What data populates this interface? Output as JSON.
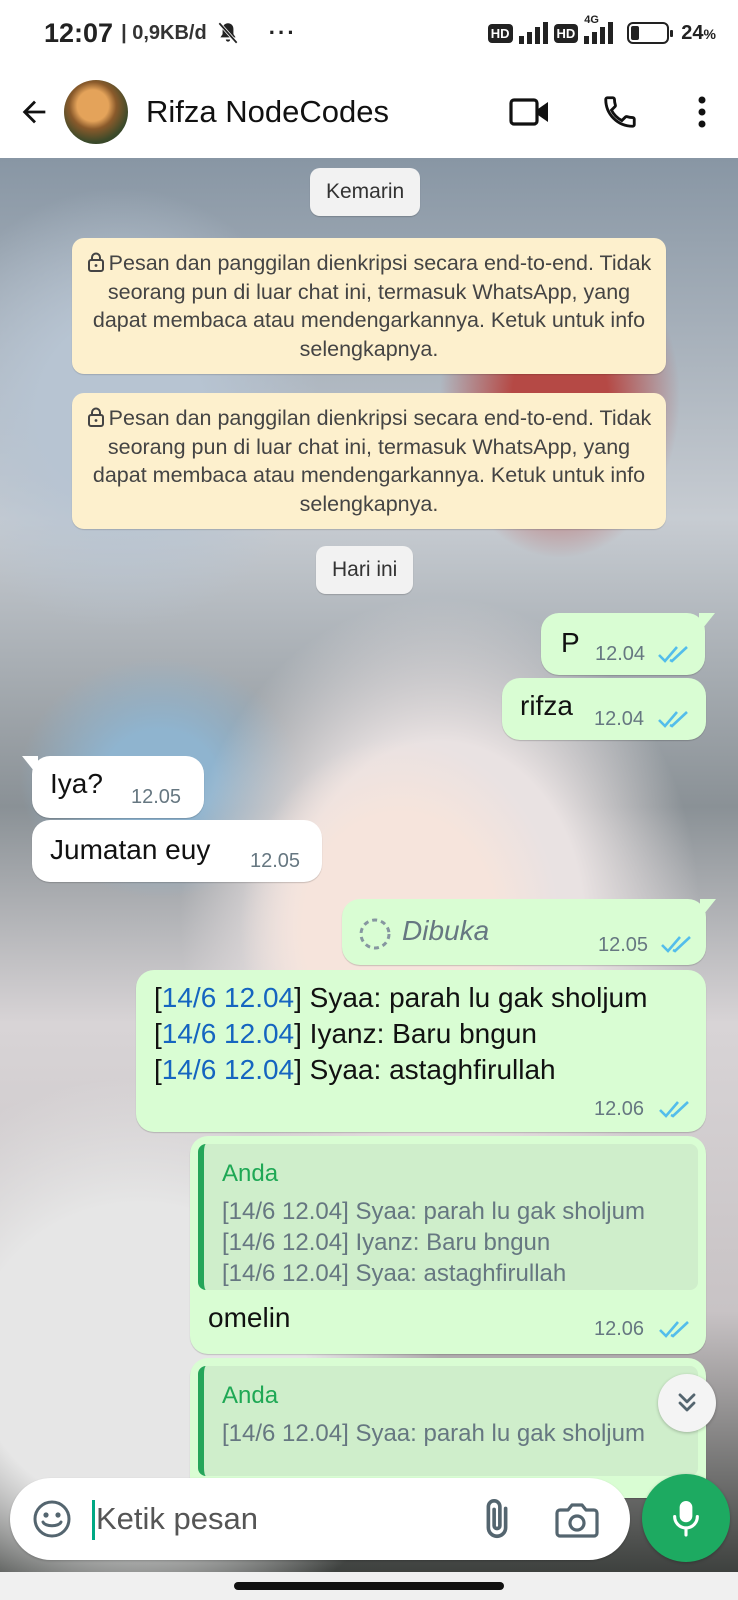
{
  "status_bar": {
    "time": "12:07",
    "network_speed": "| 0,9KB/d",
    "more": "···",
    "hd1": "HD",
    "hd2": "HD",
    "lte": "4G",
    "battery_percent": "24",
    "battery_unit": "%",
    "battery_level": 0.24
  },
  "header": {
    "contact_name": "Rifza NodeCodes"
  },
  "chat": {
    "date_yesterday": "Kemarin",
    "date_today": "Hari ini",
    "encryption_notice_1": "Pesan dan panggilan dienkripsi secara end-to-end. Tidak seorang pun di luar chat ini, termasuk WhatsApp, yang dapat membaca atau mendengarkannya. Ketuk untuk info selengkapnya.",
    "encryption_notice_2": "Pesan dan panggilan dienkripsi secara end-to-end. Tidak seorang pun di luar chat ini, termasuk WhatsApp, yang dapat membaca atau mendengarkannya. Ketuk untuk info selengkapnya.",
    "messages": [
      {
        "direction": "out",
        "text": "P",
        "time": "12.04",
        "status": "read"
      },
      {
        "direction": "out",
        "text": "rifza",
        "time": "12.04",
        "status": "read"
      },
      {
        "direction": "in",
        "text": "Iya?",
        "time": "12.05"
      },
      {
        "direction": "in",
        "text": "Jumatan euy",
        "time": "12.05"
      },
      {
        "direction": "out",
        "text": "Dibuka",
        "time": "12.05",
        "status": "read",
        "kind": "view-once-opened"
      },
      {
        "direction": "out",
        "time": "12.06",
        "status": "read",
        "lines": [
          {
            "ts": "14/6 12.04",
            "text": "] Syaa: parah lu gak sholjum"
          },
          {
            "ts": "14/6 12.04",
            "text": "] Iyanz: Baru bngun"
          },
          {
            "ts": "14/6 12.04",
            "text": "] Syaa: astaghfirullah"
          }
        ]
      },
      {
        "direction": "out",
        "time": "12.06",
        "status": "read",
        "quote_author": "Anda",
        "quote_lines": [
          "[14/6 12.04] Syaa: parah lu gak sholjum",
          "[14/6 12.04] Iyanz: Baru bngun",
          "[14/6 12.04] Syaa: astaghfirullah"
        ],
        "text": "omelin"
      },
      {
        "direction": "out",
        "quote_author": "Anda",
        "quote_lines": [
          "[14/6 12.04] Syaa: parah lu gak sholjum"
        ]
      }
    ]
  },
  "input": {
    "placeholder": "Ketik pesan"
  },
  "colors": {
    "outgoing_bubble": "#d9fdd3",
    "incoming_bubble": "#ffffff",
    "accent_green": "#1daa61",
    "read_tick_blue": "#53bdeb",
    "notice_yellow": "#fdf0cd"
  },
  "icons": {
    "back": "arrow-left-icon",
    "video": "video-camera-icon",
    "call": "phone-icon",
    "menu": "more-vertical-icon",
    "emoji": "emoji-icon",
    "attach": "paperclip-icon",
    "camera": "camera-icon",
    "mic": "microphone-icon",
    "scroll": "double-chevron-down-icon",
    "lock": "lock-icon",
    "ticks": "double-check-icon"
  }
}
